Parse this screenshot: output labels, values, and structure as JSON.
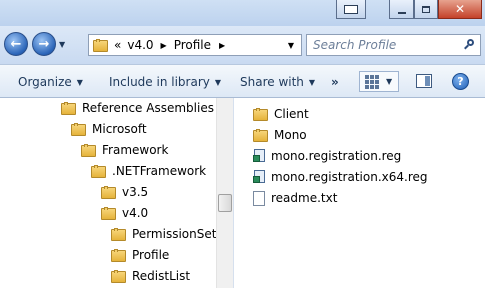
{
  "address": {
    "overflow": "«",
    "crumbs": [
      "v4.0",
      "Profile"
    ],
    "separator": "▶"
  },
  "search": {
    "placeholder": "Search Profile"
  },
  "toolbar": {
    "organize": "Organize",
    "include": "Include in library",
    "share": "Share with",
    "more": "»"
  },
  "tree": [
    {
      "label": "Reference Assemblies"
    },
    {
      "label": "Microsoft"
    },
    {
      "label": "Framework"
    },
    {
      "label": ".NETFramework"
    },
    {
      "label": "v3.5"
    },
    {
      "label": "v4.0"
    },
    {
      "label": "PermissionSets"
    },
    {
      "label": "Profile"
    },
    {
      "label": "RedistList"
    }
  ],
  "files": [
    {
      "name": "Client",
      "icon": "folder-icon"
    },
    {
      "name": "Mono",
      "icon": "folder-icon"
    },
    {
      "name": "mono.registration.reg",
      "icon": "registry-file-icon"
    },
    {
      "name": "mono.registration.x64.reg",
      "icon": "registry-file-icon"
    },
    {
      "name": "readme.txt",
      "icon": "text-file-icon"
    }
  ],
  "colors": {
    "accent": "#1e395b",
    "chrome": "#c9daf1",
    "close": "#c4422a"
  }
}
